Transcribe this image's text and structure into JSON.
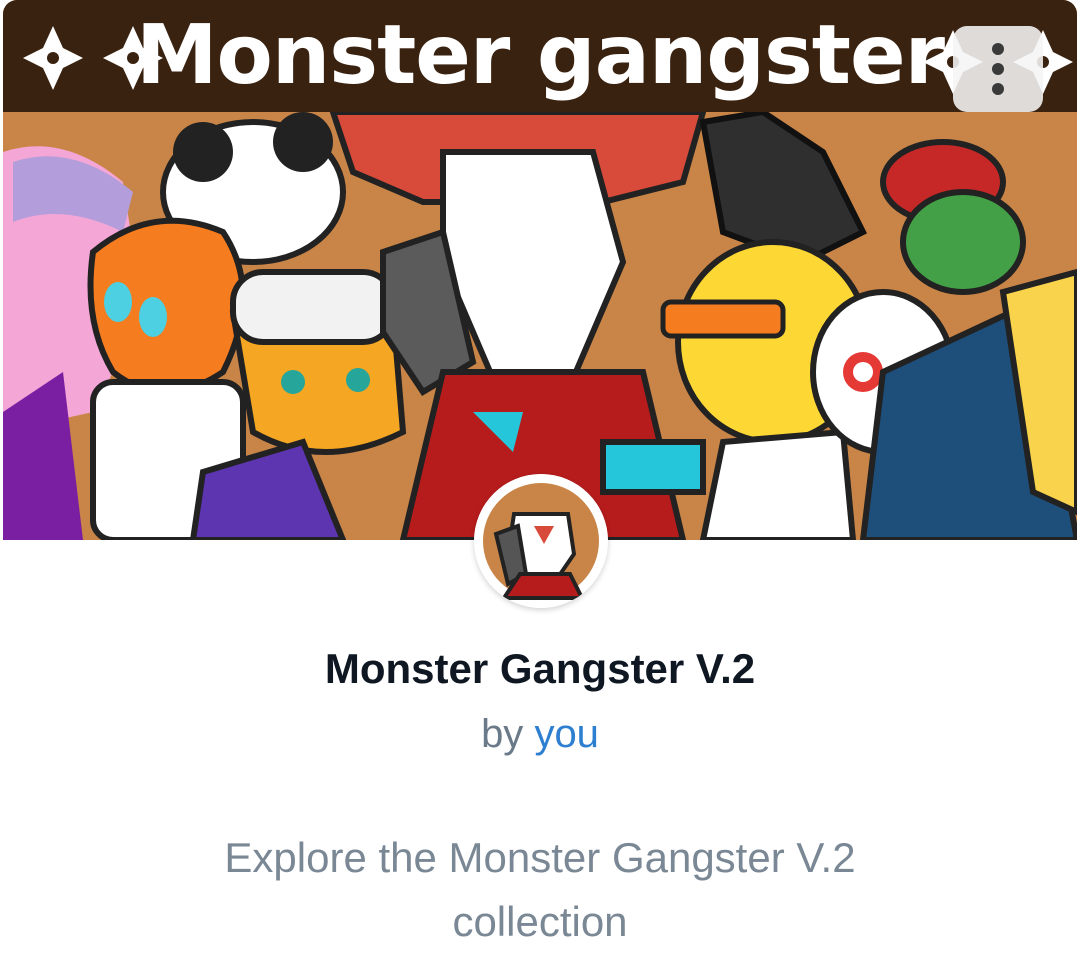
{
  "banner": {
    "title": "Monster gangster",
    "background_color": "#c98547",
    "header_color": "#3a2210"
  },
  "menu": {
    "icon": "more-vertical-icon"
  },
  "avatar": {
    "icon": "collection-avatar-image"
  },
  "collection": {
    "title": "Monster Gangster V.2",
    "by_prefix": "by",
    "author": "you",
    "description": "Explore the Monster Gangster V.2 collection"
  },
  "colors": {
    "title": "#0e1722",
    "byline": "#6b7a89",
    "author_link": "#2f7fd0",
    "description": "#7a8794"
  }
}
